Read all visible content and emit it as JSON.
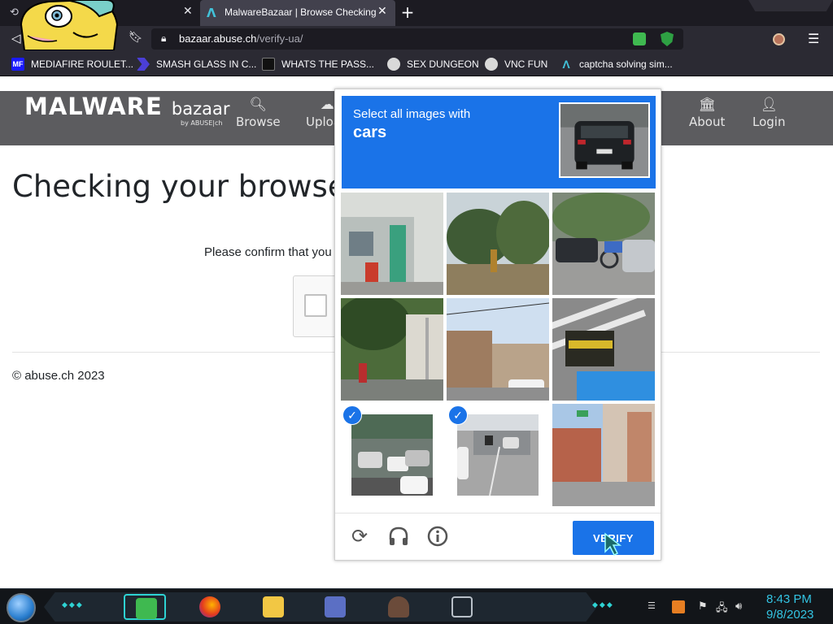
{
  "browser": {
    "tabs": [
      {
        "label": "",
        "icon": "history-icon"
      },
      {
        "label": "MalwareBazaar | Browse Checking your browser",
        "icon": "bazaar-logo-icon"
      }
    ],
    "url_host": "bazaar.abuse.ch",
    "url_path": "/verify-ua/",
    "bookmarks": [
      {
        "label": "MEDIAFIRE ROULET...",
        "icon_text": "MF",
        "color": "#1a1aff"
      },
      {
        "label": "SMASH GLASS IN C...",
        "icon_text": "",
        "color": "#4b3fd6"
      },
      {
        "label": "WHATS THE PASS...",
        "icon_text": "",
        "color": "#333333"
      },
      {
        "label": "SEX DUNGEON",
        "icon_text": "",
        "color": "#d9d9d9"
      },
      {
        "label": "VNC FUN",
        "icon_text": "",
        "color": "#d9d9d9"
      },
      {
        "label": "captcha solving sim...",
        "icon_text": "",
        "color": "#42c2d9"
      }
    ]
  },
  "site": {
    "brand_main": "MALWARE",
    "brand_sub": "bazaar",
    "brand_by": "by ABUSE|ch",
    "nav": [
      {
        "label": "Browse",
        "icon": "search-icon"
      },
      {
        "label": "Upload",
        "icon": "upload-icon"
      },
      {
        "label": "About",
        "icon": "building-icon"
      },
      {
        "label": "Login",
        "icon": "user-icon"
      }
    ],
    "title": "Checking your browser",
    "text": "Please confirm that you are human",
    "footer": "© abuse.ch 2023"
  },
  "captcha": {
    "instruction": "Select all images with",
    "target": "cars",
    "verify_label": "VERIFY",
    "selected_tiles": [
      6,
      7
    ],
    "accent": "#1a73e8"
  },
  "taskbar": {
    "time": "8:43 PM",
    "date": "9/8/2023"
  }
}
